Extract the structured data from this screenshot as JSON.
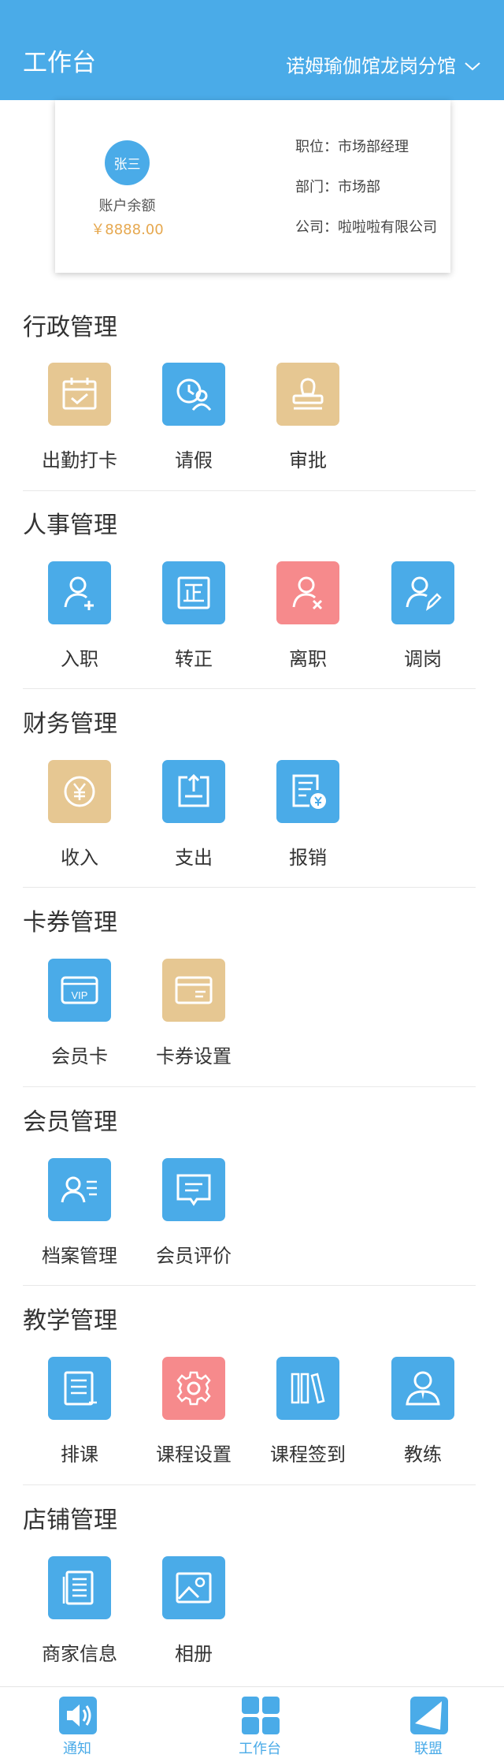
{
  "header": {
    "title": "工作台",
    "branch": "诺姆瑜伽馆龙岗分馆"
  },
  "profile": {
    "avatar_text": "张三",
    "balance_label": "账户余额",
    "balance_value": "￥8888.00",
    "position": "职位：市场部经理",
    "department": "部门：市场部",
    "company": "公司：啦啦啦有限公司"
  },
  "sections": {
    "admin": {
      "title": "行政管理",
      "items": [
        "出勤打卡",
        "请假",
        "审批"
      ]
    },
    "hr": {
      "title": "人事管理",
      "items": [
        "入职",
        "转正",
        "离职",
        "调岗"
      ]
    },
    "finance": {
      "title": "财务管理",
      "items": [
        "收入",
        "支出",
        "报销"
      ]
    },
    "cards": {
      "title": "卡券管理",
      "items": [
        "会员卡",
        "卡券设置"
      ]
    },
    "members": {
      "title": "会员管理",
      "items": [
        "档案管理",
        "会员评价"
      ]
    },
    "teaching": {
      "title": "教学管理",
      "items": [
        "排课",
        "课程设置",
        "课程签到",
        "教练"
      ]
    },
    "store": {
      "title": "店铺管理",
      "items": [
        "商家信息",
        "相册"
      ]
    }
  },
  "tabbar": {
    "items": [
      "通知",
      "工作台",
      "联盟"
    ]
  },
  "colors": {
    "accent": "#4aabe8",
    "tan": "#e6c792",
    "pink": "#f68a8c",
    "balance": "#e6a84f"
  }
}
